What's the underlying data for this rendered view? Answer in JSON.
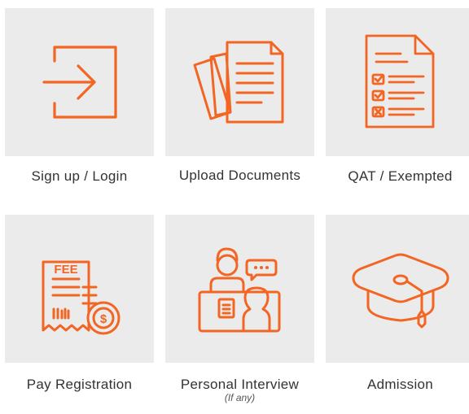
{
  "theme": {
    "accent": "#f26522",
    "tile_bg": "#ebebeb",
    "text": "#333333"
  },
  "steps": [
    {
      "label": "Sign up / Login",
      "icon": "login-icon"
    },
    {
      "label": "Upload Documents",
      "icon": "documents-icon"
    },
    {
      "label": "QAT / Exempted",
      "icon": "checklist-icon"
    },
    {
      "label": "Pay Registration",
      "icon": "fee-receipt-icon",
      "icon_text": "FEE"
    },
    {
      "label": "Personal Interview",
      "sublabel": "(If any)",
      "icon": "interview-icon"
    },
    {
      "label": "Admission",
      "icon": "graduation-cap-icon"
    }
  ]
}
